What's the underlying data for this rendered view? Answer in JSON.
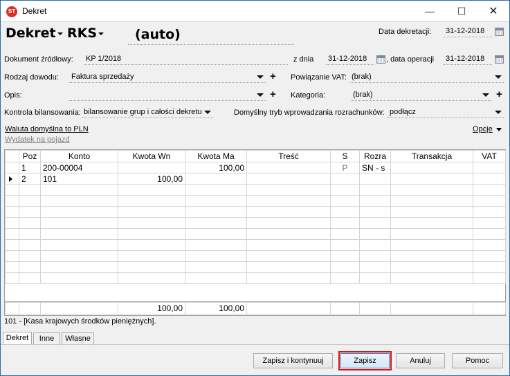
{
  "window": {
    "title": "Dekret"
  },
  "header": {
    "doc_type": "Dekret",
    "register": "RKS",
    "number": "(auto)",
    "date_label": "Data dekretacji:",
    "date_value": "31-12-2018"
  },
  "source_doc": {
    "label": "Dokument źródłowy:",
    "value": "KP 1/2018",
    "from_label": "z dnia",
    "from_value": "31-12-2018",
    "op_label": ", data operacji",
    "op_value": "31-12-2018"
  },
  "proof_type": {
    "label": "Rodzaj dowodu:",
    "value": "Faktura sprzedaży"
  },
  "vat_link": {
    "label": "Powiązanie VAT:",
    "value": "(brak)"
  },
  "description": {
    "label": "Opis:",
    "value": ""
  },
  "category": {
    "label": "Kategoria:",
    "value": "(brak)"
  },
  "balance_control": {
    "label": "Kontrola bilansowania:",
    "value": "bilansowanie grup i całości dekretu"
  },
  "settlement_mode": {
    "label": "Domyślny tryb wprowadzania rozrachunków:",
    "value": "podłącz"
  },
  "links": {
    "currency": "Waluta domyślna to PLN",
    "vehicle": "Wydatek na pojazd",
    "options": "Opcje"
  },
  "grid": {
    "columns": [
      "Poz",
      "Konto",
      "Kwota Wn",
      "Kwota Ma",
      "Treść",
      "S",
      "Rozra",
      "Transakcja",
      "VAT"
    ],
    "rows": [
      {
        "poz": "1",
        "konto": "200-00004",
        "wn": "",
        "ma": "100,00",
        "tresc": "",
        "s": "P",
        "rozra": "SN - s",
        "trans": "",
        "vat": ""
      },
      {
        "poz": "2",
        "konto": "101",
        "wn": "100,00",
        "ma": "",
        "tresc": "",
        "s": "",
        "rozra": "",
        "trans": "",
        "vat": ""
      }
    ],
    "total_wn": "100,00",
    "total_ma": "100,00"
  },
  "status": "101 - [Kasa krajowych środków pieniężnych].",
  "tabs": [
    "Dekret",
    "Inne",
    "Własne"
  ],
  "buttons": {
    "save_continue": "Zapisz i kontynuuj",
    "save": "Zapisz",
    "cancel": "Anuluj",
    "help": "Pomoc"
  }
}
